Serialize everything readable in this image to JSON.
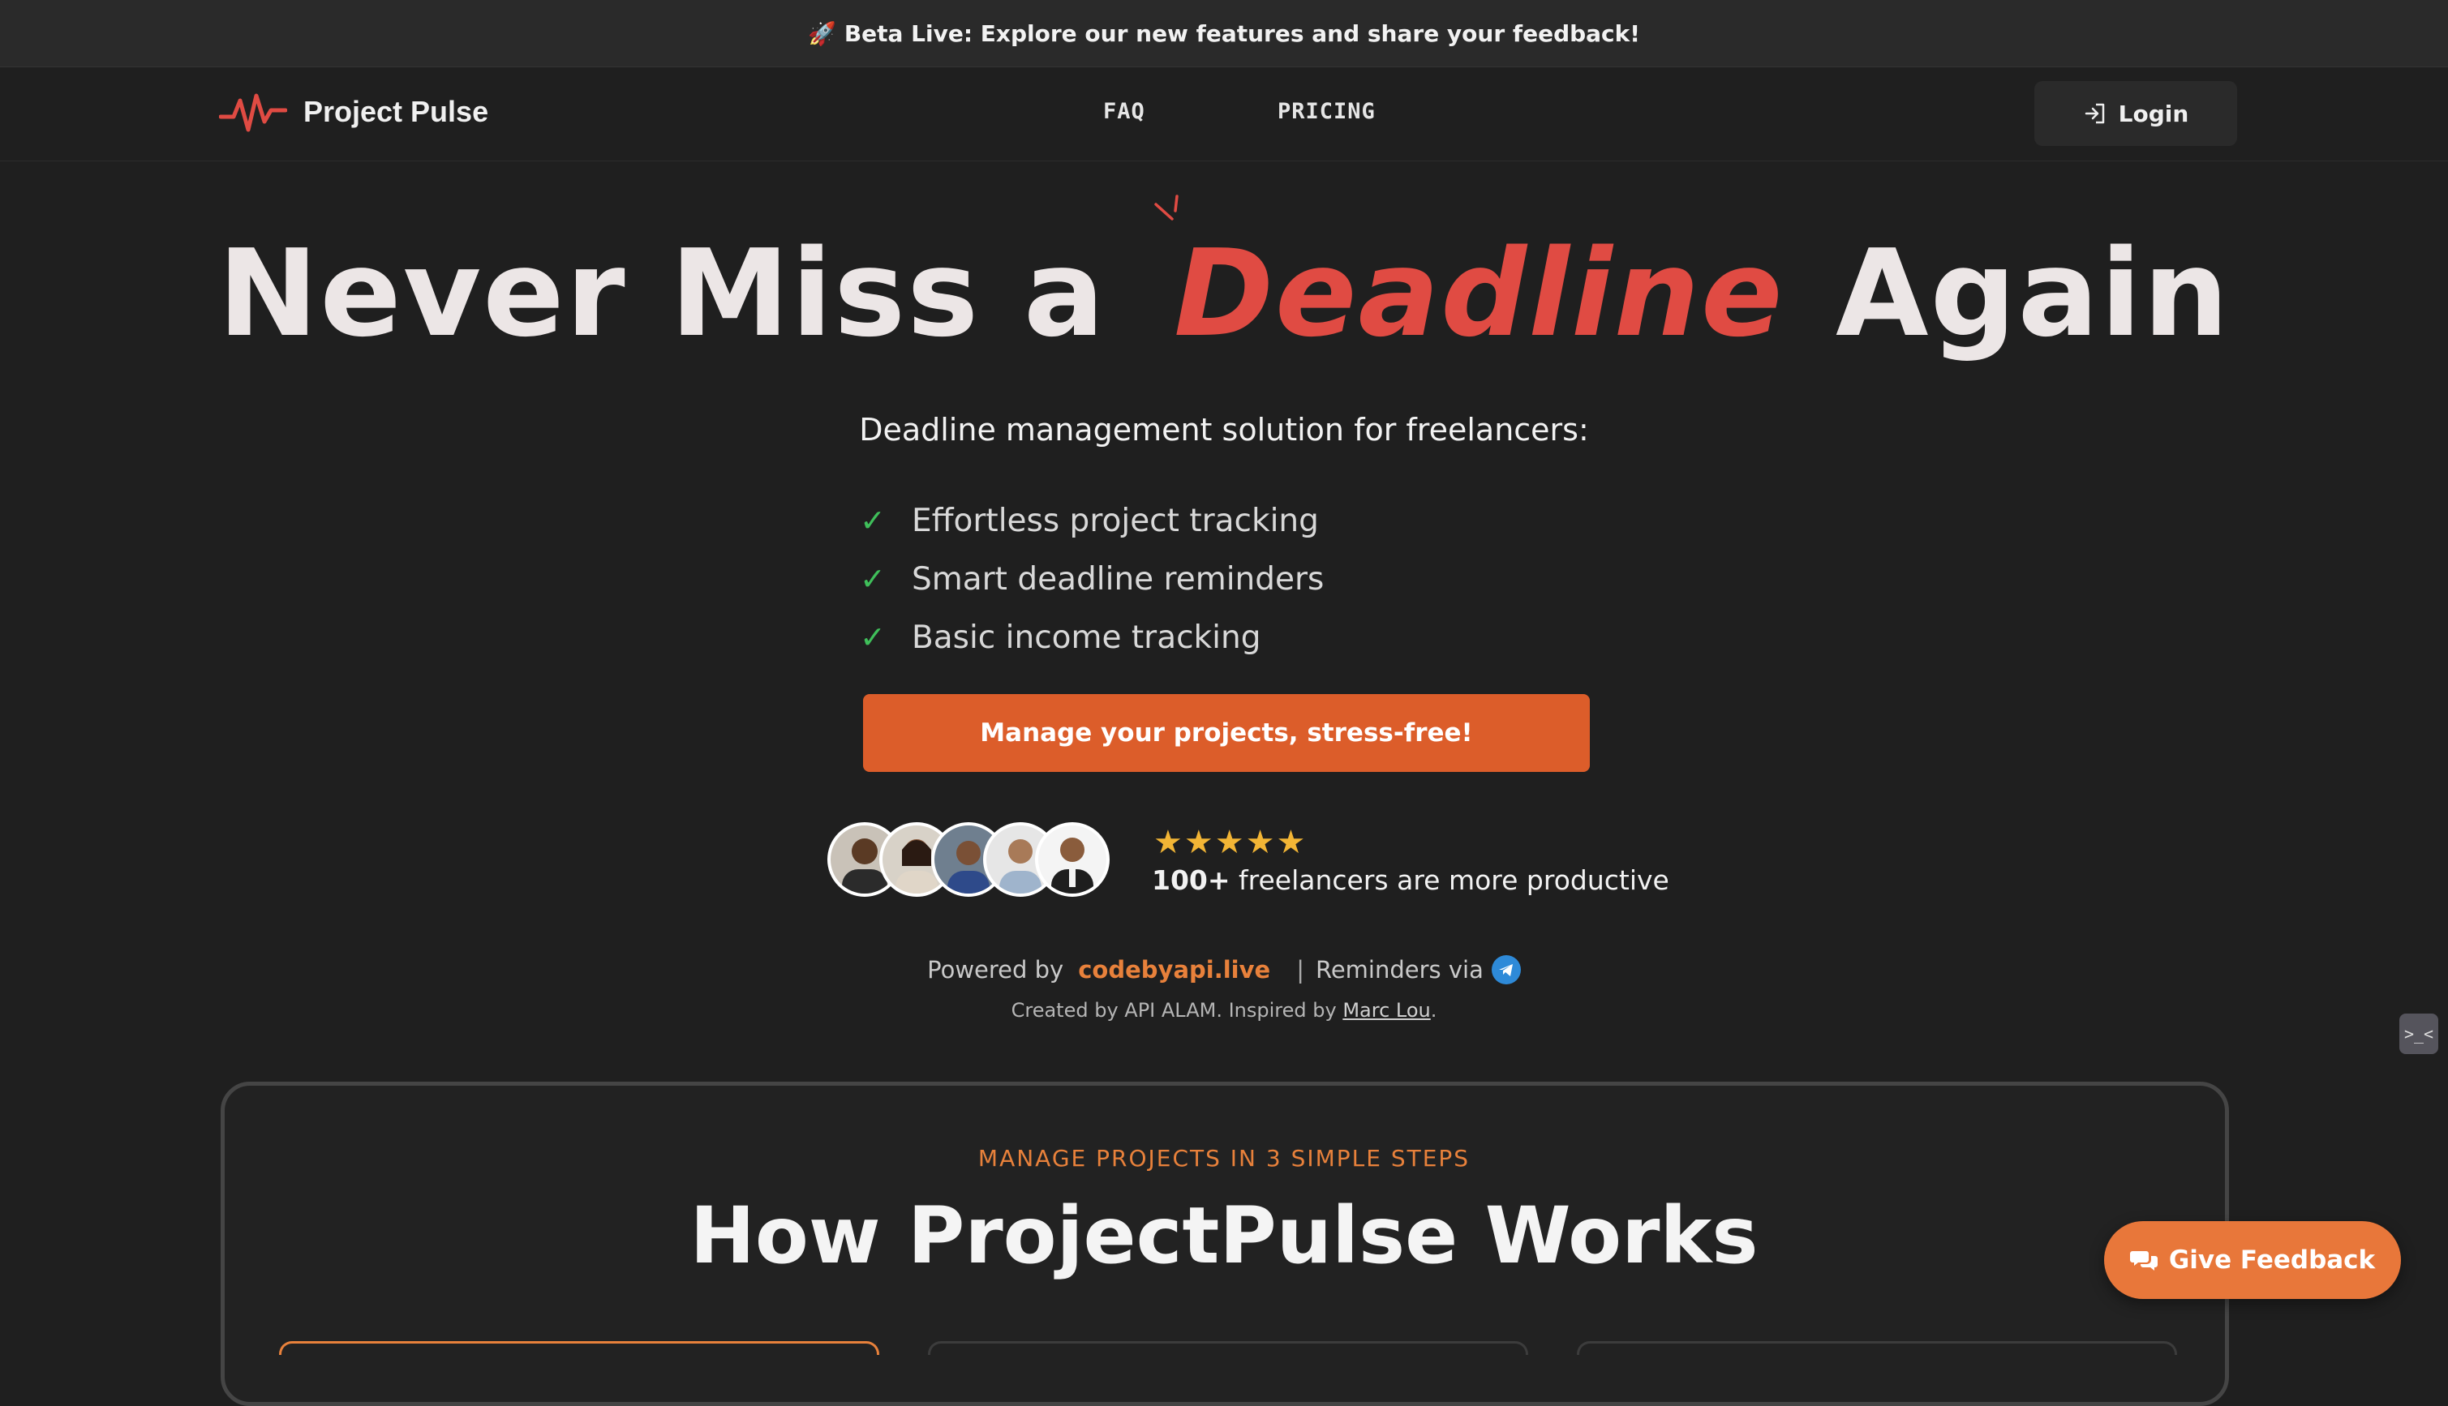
{
  "banner": {
    "icon": "rocket-icon",
    "text": "Beta Live: Explore our new features and share your feedback!"
  },
  "header": {
    "logo_icon": "pulse-icon",
    "brand": "Project Pulse",
    "nav": [
      {
        "label": "FAQ"
      },
      {
        "label": "PRICING"
      }
    ],
    "login": {
      "icon": "login-icon",
      "label": "Login"
    }
  },
  "hero": {
    "title_before": "Never Miss a ",
    "title_accent": "Deadline",
    "title_after": " Again",
    "subtitle": "Deadline management solution for freelancers:",
    "features": [
      "Effortless project tracking",
      "Smart deadline reminders",
      "Basic income tracking"
    ],
    "cta": "Manage your projects, stress-free!"
  },
  "social_proof": {
    "rating": 5,
    "stars": "★★★★★",
    "count": "100+",
    "text": " freelancers are more productive",
    "avatars": [
      "avatar-1",
      "avatar-2",
      "avatar-3",
      "avatar-4",
      "avatar-5"
    ]
  },
  "powered": {
    "prefix": "Powered by",
    "brand": "codebyapi.live",
    "sep": "|",
    "reminders": "Reminders via",
    "reminders_icon": "telegram-icon"
  },
  "credits": {
    "prefix": "Created by API ALAM. Inspired by ",
    "link": "Marc Lou",
    "suffix": "."
  },
  "section": {
    "kicker": "MANAGE PROJECTS IN 3 SIMPLE STEPS",
    "title": "How ProjectPulse Works"
  },
  "feedback_button": {
    "icon": "chat-bubbles-icon",
    "label": "Give Feedback"
  },
  "colors": {
    "background": "#1f1f1f",
    "accent_red": "#e04b43",
    "accent_orange": "#dc5d2a",
    "check_green": "#3fbf5a",
    "star_gold": "#f2b535",
    "telegram_blue": "#2e8ad8"
  }
}
